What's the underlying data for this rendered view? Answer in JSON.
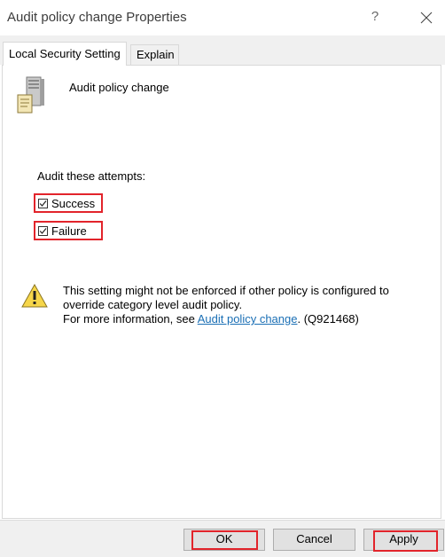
{
  "window": {
    "title": "Audit policy change Properties",
    "help_glyph": "?"
  },
  "tabs": [
    {
      "label": "Local Security Setting",
      "active": true
    },
    {
      "label": "Explain",
      "active": false
    }
  ],
  "policy": {
    "name": "Audit policy change",
    "icon": "server-policy-icon"
  },
  "audit": {
    "label": "Audit these attempts:",
    "success": {
      "label": "Success",
      "checked": true
    },
    "failure": {
      "label": "Failure",
      "checked": true
    }
  },
  "warning": {
    "icon": "warning-icon",
    "line1": "This setting might not be enforced if other policy is configured to",
    "line2": "override category level audit policy.",
    "line3_prefix": "For more information, see ",
    "link_text": "Audit policy change",
    "line3_suffix": ". (Q921468)"
  },
  "buttons": {
    "ok": "OK",
    "cancel": "Cancel",
    "apply": "Apply"
  },
  "colors": {
    "highlight": "#e2242b",
    "link": "#1a6fb5",
    "footer_bg": "#f0f0f0"
  }
}
